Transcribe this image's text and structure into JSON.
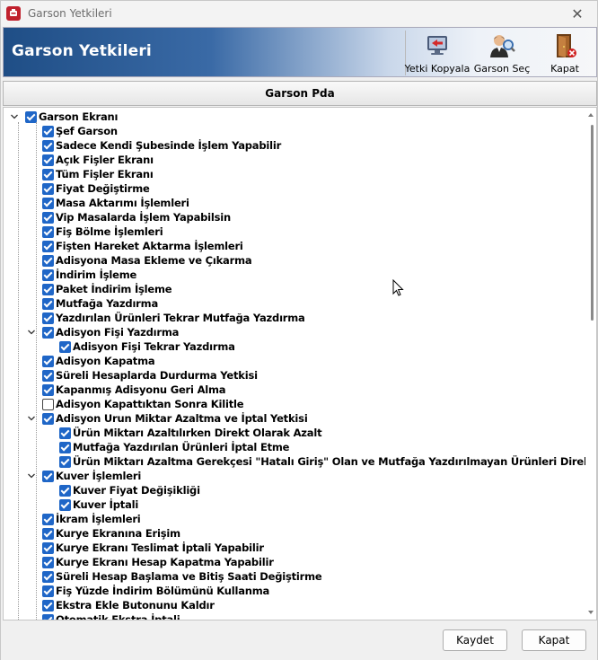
{
  "window": {
    "title": "Garson Yetkileri",
    "close_glyph": "✕"
  },
  "header": {
    "title": "Garson Yetkileri",
    "buttons": [
      {
        "label": "Yetki Kopyala",
        "icon": "copy-permissions-icon"
      },
      {
        "label": "Garson Seç",
        "icon": "select-waiter-icon"
      },
      {
        "label": "Kapat",
        "icon": "exit-door-icon"
      }
    ]
  },
  "section": {
    "title": "Garson Pda"
  },
  "tree": [
    {
      "label": "Garson Ekranı",
      "level": 0,
      "checked": true,
      "expandable": true
    },
    {
      "label": "Şef Garson",
      "level": 1,
      "checked": true
    },
    {
      "label": "Sadece Kendi Şubesinde İşlem Yapabilir",
      "level": 1,
      "checked": true
    },
    {
      "label": "Açık Fişler Ekranı",
      "level": 1,
      "checked": true
    },
    {
      "label": "Tüm Fişler Ekranı",
      "level": 1,
      "checked": true
    },
    {
      "label": "Fiyat Değiştirme",
      "level": 1,
      "checked": true
    },
    {
      "label": "Masa Aktarımı İşlemleri",
      "level": 1,
      "checked": true
    },
    {
      "label": "Vip Masalarda İşlem Yapabilsin",
      "level": 1,
      "checked": true
    },
    {
      "label": "Fiş Bölme İşlemleri",
      "level": 1,
      "checked": true
    },
    {
      "label": "Fişten Hareket Aktarma İşlemleri",
      "level": 1,
      "checked": true
    },
    {
      "label": "Adisyona Masa Ekleme ve Çıkarma",
      "level": 1,
      "checked": true
    },
    {
      "label": "İndirim İşleme",
      "level": 1,
      "checked": true
    },
    {
      "label": "Paket İndirim İşleme",
      "level": 1,
      "checked": true
    },
    {
      "label": "Mutfağa Yazdırma",
      "level": 1,
      "checked": true
    },
    {
      "label": "Yazdırılan Ürünleri Tekrar Mutfağa Yazdırma",
      "level": 1,
      "checked": true
    },
    {
      "label": "Adisyon Fişi Yazdırma",
      "level": 1,
      "checked": true,
      "expandable": true
    },
    {
      "label": "Adisyon Fişi Tekrar Yazdırma",
      "level": 2,
      "checked": true
    },
    {
      "label": "Adisyon Kapatma",
      "level": 1,
      "checked": true
    },
    {
      "label": "Süreli Hesaplarda Durdurma Yetkisi",
      "level": 1,
      "checked": true
    },
    {
      "label": "Kapanmış Adisyonu Geri Alma",
      "level": 1,
      "checked": true
    },
    {
      "label": "Adisyon Kapattıktan Sonra Kilitle",
      "level": 1,
      "checked": false
    },
    {
      "label": "Adisyon Urun Miktar Azaltma ve İptal Yetkisi",
      "level": 1,
      "checked": true,
      "expandable": true
    },
    {
      "label": "Ürün Miktarı Azaltılırken Direkt Olarak Azalt",
      "level": 2,
      "checked": true
    },
    {
      "label": "Mutfağa Yazdırılan Ürünleri İptal Etme",
      "level": 2,
      "checked": true
    },
    {
      "label": "Ürün Miktarı Azaltma Gerekçesi \"Hatalı Giriş\" Olan ve Mutfağa Yazdırılmayan Ürünleri Direkt Sil",
      "level": 2,
      "checked": true
    },
    {
      "label": "Kuver İşlemleri",
      "level": 1,
      "checked": true,
      "expandable": true
    },
    {
      "label": "Kuver Fiyat Değişikliği",
      "level": 2,
      "checked": true
    },
    {
      "label": "Kuver İptali",
      "level": 2,
      "checked": true
    },
    {
      "label": "İkram İşlemleri",
      "level": 1,
      "checked": true
    },
    {
      "label": "Kurye Ekranına Erişim",
      "level": 1,
      "checked": true
    },
    {
      "label": "Kurye Ekranı Teslimat İptali Yapabilir",
      "level": 1,
      "checked": true
    },
    {
      "label": "Kurye Ekranı Hesap Kapatma Yapabilir",
      "level": 1,
      "checked": true
    },
    {
      "label": "Süreli Hesap Başlama ve Bitiş Saati Değiştirme",
      "level": 1,
      "checked": true
    },
    {
      "label": "Fiş Yüzde İndirim Bölümünü Kullanma",
      "level": 1,
      "checked": true
    },
    {
      "label": "Ekstra Ekle Butonunu Kaldır",
      "level": 1,
      "checked": true
    },
    {
      "label": "Otomatik Ekstra İptali",
      "level": 1,
      "checked": true
    }
  ],
  "footer": {
    "save_label": "Kaydet",
    "close_label": "Kapat"
  },
  "colors": {
    "checkbox_checked": "#1f66c7",
    "header_gradient_start": "#1f4e86"
  }
}
